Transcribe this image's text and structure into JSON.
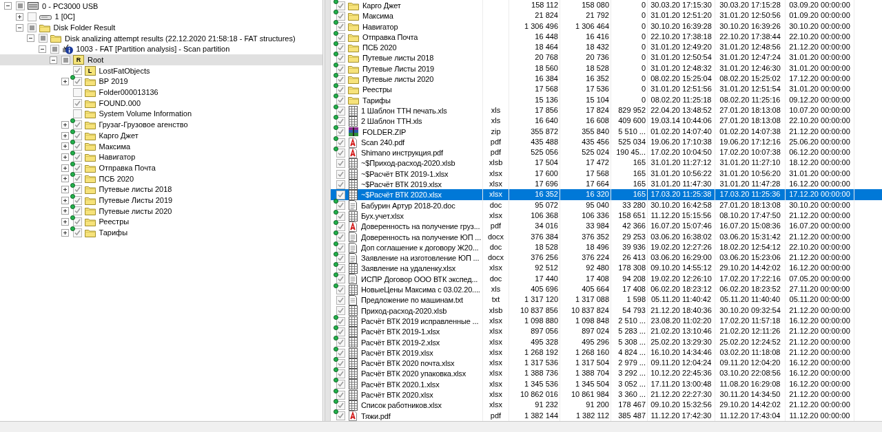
{
  "tree": [
    {
      "label": "0 - PC3000 USB",
      "kind": "drive",
      "checked": false,
      "indeterminate": true,
      "expanded": true,
      "marked": false,
      "selected": false,
      "children": [
        {
          "label": "1 [0C]",
          "kind": "disk",
          "checked": false,
          "indeterminate": false,
          "expanded": false,
          "marked": false,
          "selected": false
        },
        {
          "label": "Disk Folder Result",
          "kind": "folder",
          "checked": false,
          "indeterminate": true,
          "expanded": true,
          "marked": false,
          "selected": false,
          "children": [
            {
              "label": "Disk analizing attempt results (22.12.2020 21:58:18 - FAT structures)",
              "kind": "folder",
              "checked": false,
              "indeterminate": true,
              "expanded": true,
              "marked": false,
              "selected": false,
              "children": [
                {
                  "label": "1003 - FAT [Partition analysis] - Scan partition",
                  "kind": "info",
                  "checked": false,
                  "indeterminate": true,
                  "expanded": true,
                  "marked": false,
                  "selected": false,
                  "children": [
                    {
                      "label": "Root",
                      "kind": "lettered",
                      "letter": "R",
                      "checked": false,
                      "indeterminate": true,
                      "expanded": true,
                      "marked": false,
                      "selected": true,
                      "children": [
                        {
                          "label": "LostFatObjects",
                          "kind": "lettered",
                          "letter": "L",
                          "checked": true,
                          "indeterminate": false,
                          "marked": false,
                          "selected": false
                        },
                        {
                          "label": "ВР 2019",
                          "kind": "folder",
                          "checked": true,
                          "indeterminate": false,
                          "expanded": false,
                          "marked": true,
                          "selected": false
                        },
                        {
                          "label": "Folder000013136",
                          "kind": "folder",
                          "checked": false,
                          "indeterminate": false,
                          "marked": false,
                          "selected": false
                        },
                        {
                          "label": "FOUND.000",
                          "kind": "folder",
                          "checked": true,
                          "indeterminate": false,
                          "marked": false,
                          "selected": false
                        },
                        {
                          "label": "System Volume Information",
                          "kind": "folder",
                          "checked": false,
                          "indeterminate": false,
                          "marked": false,
                          "selected": false
                        },
                        {
                          "label": "Грузаг-Грузовое агенство",
                          "kind": "folder",
                          "checked": true,
                          "indeterminate": false,
                          "expanded": false,
                          "marked": true,
                          "selected": false
                        },
                        {
                          "label": "Карго Джет",
                          "kind": "folder",
                          "checked": true,
                          "indeterminate": false,
                          "expanded": false,
                          "marked": true,
                          "selected": false
                        },
                        {
                          "label": "Максима",
                          "kind": "folder",
                          "checked": true,
                          "indeterminate": false,
                          "expanded": false,
                          "marked": true,
                          "selected": false
                        },
                        {
                          "label": "Навигатор",
                          "kind": "folder",
                          "checked": true,
                          "indeterminate": false,
                          "expanded": false,
                          "marked": true,
                          "selected": false
                        },
                        {
                          "label": "Отправка Почта",
                          "kind": "folder",
                          "checked": true,
                          "indeterminate": false,
                          "expanded": false,
                          "marked": true,
                          "selected": false
                        },
                        {
                          "label": "ПСБ 2020",
                          "kind": "folder",
                          "checked": true,
                          "indeterminate": false,
                          "expanded": false,
                          "marked": true,
                          "selected": false
                        },
                        {
                          "label": "Путевые листы 2018",
                          "kind": "folder",
                          "checked": true,
                          "indeterminate": false,
                          "expanded": false,
                          "marked": true,
                          "selected": false
                        },
                        {
                          "label": "Путевые Листы 2019",
                          "kind": "folder",
                          "checked": true,
                          "indeterminate": false,
                          "expanded": false,
                          "marked": true,
                          "selected": false
                        },
                        {
                          "label": "Путевые листы 2020",
                          "kind": "folder",
                          "checked": true,
                          "indeterminate": false,
                          "expanded": false,
                          "marked": true,
                          "selected": false
                        },
                        {
                          "label": "Реестры",
                          "kind": "folder",
                          "checked": true,
                          "indeterminate": false,
                          "expanded": false,
                          "marked": true,
                          "selected": false
                        },
                        {
                          "label": "Тарифы",
                          "kind": "folder",
                          "checked": true,
                          "indeterminate": false,
                          "expanded": false,
                          "marked": true,
                          "selected": false
                        }
                      ]
                    }
                  ]
                }
              ]
            }
          ]
        }
      ]
    }
  ],
  "files": [
    {
      "name": "Карго Джет",
      "kind": "folder",
      "checked": true,
      "marked": true,
      "selected": false,
      "cells": [
        "158 112",
        "158 080",
        "0",
        "30.03.20 17:15:30",
        "30.03.20 17:15:28",
        "03.09.20 00:00:00"
      ]
    },
    {
      "name": "Максима",
      "kind": "folder",
      "checked": true,
      "marked": true,
      "selected": false,
      "cells": [
        "21 824",
        "21 792",
        "0",
        "31.01.20 12:51:20",
        "31.01.20 12:50:56",
        "01.09.20 00:00:00"
      ]
    },
    {
      "name": "Навигатор",
      "kind": "folder",
      "checked": true,
      "marked": true,
      "selected": false,
      "cells": [
        "1 306 496",
        "1 306 464",
        "0",
        "30.10.20 16:39:28",
        "30.10.20 16:39:26",
        "30.10.20 00:00:00"
      ]
    },
    {
      "name": "Отправка Почта",
      "kind": "folder",
      "checked": true,
      "marked": true,
      "selected": false,
      "cells": [
        "16 448",
        "16 416",
        "0",
        "22.10.20 17:38:18",
        "22.10.20 17:38:44",
        "22.10.20 00:00:00"
      ]
    },
    {
      "name": "ПСБ 2020",
      "kind": "folder",
      "checked": true,
      "marked": true,
      "selected": false,
      "cells": [
        "18 464",
        "18 432",
        "0",
        "31.01.20 12:49:20",
        "31.01.20 12:48:56",
        "21.12.20 00:00:00"
      ]
    },
    {
      "name": "Путевые листы 2018",
      "kind": "folder",
      "checked": true,
      "marked": true,
      "selected": false,
      "cells": [
        "20 768",
        "20 736",
        "0",
        "31.01.20 12:50:54",
        "31.01.20 12:47:24",
        "31.01.20 00:00:00"
      ]
    },
    {
      "name": "Путевые Листы 2019",
      "kind": "folder",
      "checked": true,
      "marked": true,
      "selected": false,
      "cells": [
        "18 560",
        "18 528",
        "0",
        "31.01.20 12:48:32",
        "31.01.20 12:46:30",
        "31.01.20 00:00:00"
      ]
    },
    {
      "name": "Путевые листы 2020",
      "kind": "folder",
      "checked": true,
      "marked": true,
      "selected": false,
      "cells": [
        "16 384",
        "16 352",
        "0",
        "08.02.20 15:25:04",
        "08.02.20 15:25:02",
        "17.12.20 00:00:00"
      ]
    },
    {
      "name": "Реестры",
      "kind": "folder",
      "checked": true,
      "marked": true,
      "selected": false,
      "cells": [
        "17 568",
        "17 536",
        "0",
        "31.01.20 12:51:56",
        "31.01.20 12:51:54",
        "31.01.20 00:00:00"
      ]
    },
    {
      "name": "Тарифы",
      "kind": "folder",
      "checked": true,
      "marked": true,
      "selected": false,
      "cells": [
        "15 136",
        "15 104",
        "0",
        "08.02.20 11:25:18",
        "08.02.20 11:25:16",
        "09.12.20 00:00:00"
      ]
    },
    {
      "name": "1 Шаблон ТТН печать.xls",
      "ext": "xls",
      "kind": "sheet",
      "checked": true,
      "marked": true,
      "selected": false,
      "cells": [
        "17 856",
        "17 824",
        "829 952",
        "22.04.20 13:48:52",
        "27.01.20 18:13:08",
        "10.07.20 00:00:00"
      ]
    },
    {
      "name": "2 Шаблон ТТН.xls",
      "ext": "xls",
      "kind": "sheet",
      "checked": true,
      "marked": true,
      "selected": false,
      "cells": [
        "16 640",
        "16 608",
        "409 600",
        "19.03.14 10:44:06",
        "27.01.20 18:13:08",
        "22.10.20 00:00:00"
      ]
    },
    {
      "name": "FOLDER.ZIP",
      "ext": "zip",
      "kind": "archive",
      "checked": true,
      "marked": true,
      "selected": false,
      "cells": [
        "355 872",
        "355 840",
        "5 510 ...",
        "01.02.20 14:07:40",
        "01.02.20 14:07:38",
        "21.12.20 00:00:00"
      ]
    },
    {
      "name": "Scan 240.pdf",
      "ext": "pdf",
      "kind": "pdf",
      "checked": true,
      "marked": true,
      "selected": false,
      "cells": [
        "435 488",
        "435 456",
        "525 034",
        "19.06.20 17:10:38",
        "19.06.20 17:12:16",
        "25.06.20 00:00:00"
      ]
    },
    {
      "name": "Shimano инструкция.pdf",
      "ext": "pdf",
      "kind": "pdf",
      "checked": true,
      "marked": true,
      "selected": false,
      "cells": [
        "525 056",
        "525 024",
        "190 45...",
        "17.02.20 10:04:50",
        "17.02.20 10:07:38",
        "06.12.20 00:00:00"
      ]
    },
    {
      "name": "~$Приход-расход-2020.xlsb",
      "ext": "xlsb",
      "kind": "sheet",
      "checked": true,
      "marked": false,
      "selected": false,
      "cells": [
        "17 504",
        "17 472",
        "165",
        "31.01.20 11:27:12",
        "31.01.20 11:27:10",
        "18.12.20 00:00:00"
      ]
    },
    {
      "name": "~$Расчёт ВТК 2019-1.xlsx",
      "ext": "xlsx",
      "kind": "sheet",
      "checked": true,
      "marked": false,
      "selected": false,
      "cells": [
        "17 600",
        "17 568",
        "165",
        "31.01.20 10:56:22",
        "31.01.20 10:56:20",
        "31.01.20 00:00:00"
      ]
    },
    {
      "name": "~$Расчёт ВТК 2019.xlsx",
      "ext": "xlsx",
      "kind": "sheet",
      "checked": true,
      "marked": false,
      "selected": false,
      "cells": [
        "17 696",
        "17 664",
        "165",
        "31.01.20 11:47:30",
        "31.01.20 11:47:28",
        "16.12.20 00:00:00"
      ]
    },
    {
      "name": "~$Расчёт ВТК 2020.xlsx",
      "ext": "xlsx",
      "kind": "sheet",
      "checked": true,
      "marked": false,
      "selected": true,
      "cells": [
        "16 352",
        "16 320",
        "165",
        "17.03.20 11:25:38",
        "17.03.20 11:25:36",
        "17.12.20 00:00:00"
      ]
    },
    {
      "name": "Бабурин Артур 2018-20.doc",
      "ext": "doc",
      "kind": "doc",
      "checked": true,
      "marked": true,
      "selected": false,
      "cells": [
        "95 072",
        "95 040",
        "33 280",
        "30.10.20 16:42:58",
        "27.01.20 18:13:08",
        "30.10.20 00:00:00"
      ]
    },
    {
      "name": "Бух.учет.xlsx",
      "ext": "xlsx",
      "kind": "sheet",
      "checked": true,
      "marked": true,
      "selected": false,
      "cells": [
        "106 368",
        "106 336",
        "158 651",
        "11.12.20 15:15:56",
        "08.10.20 17:47:50",
        "21.12.20 00:00:00"
      ]
    },
    {
      "name": "Доверенность на получение груз...",
      "ext": "pdf",
      "kind": "pdf",
      "checked": true,
      "marked": true,
      "selected": false,
      "cells": [
        "34 016",
        "33 984",
        "42 366",
        "16.07.20 15:07:46",
        "16.07.20 15:08:36",
        "16.07.20 00:00:00"
      ]
    },
    {
      "name": "Доверенность на получение ЮП ...",
      "ext": "docx",
      "kind": "doc",
      "checked": true,
      "marked": true,
      "selected": false,
      "cells": [
        "376 384",
        "376 352",
        "29 253",
        "03.06.20 16:38:02",
        "03.06.20 15:31:42",
        "21.12.20 00:00:00"
      ]
    },
    {
      "name": "Доп соглашение к договору Ж20...",
      "ext": "doc",
      "kind": "doc",
      "checked": true,
      "marked": true,
      "selected": false,
      "cells": [
        "18 528",
        "18 496",
        "39 936",
        "19.02.20 12:27:26",
        "18.02.20 12:54:12",
        "22.10.20 00:00:00"
      ]
    },
    {
      "name": "Заявление на изготовление ЮП ...",
      "ext": "docx",
      "kind": "doc",
      "checked": true,
      "marked": true,
      "selected": false,
      "cells": [
        "376 256",
        "376 224",
        "26 413",
        "03.06.20 16:29:00",
        "03.06.20 15:23:06",
        "21.12.20 00:00:00"
      ]
    },
    {
      "name": "Заявление на удаленку.xlsx",
      "ext": "xlsx",
      "kind": "sheet",
      "checked": true,
      "marked": true,
      "selected": false,
      "cells": [
        "92 512",
        "92 480",
        "178 308",
        "09.10.20 14:55:12",
        "29.10.20 14:42:02",
        "16.12.20 00:00:00"
      ]
    },
    {
      "name": "ИСПР Договор ООО ВТК экспед...",
      "ext": "doc",
      "kind": "doc",
      "checked": true,
      "marked": true,
      "selected": false,
      "cells": [
        "17 440",
        "17 408",
        "94 208",
        "19.02.20 12:26:10",
        "17.02.20 17:22:16",
        "07.05.20 00:00:00"
      ]
    },
    {
      "name": "НовыеЦены Максима с 03.02.20....",
      "ext": "xls",
      "kind": "sheet",
      "checked": true,
      "marked": true,
      "selected": false,
      "cells": [
        "405 696",
        "405 664",
        "17 408",
        "06.02.20 18:23:12",
        "06.02.20 18:23:52",
        "27.11.20 00:00:00"
      ]
    },
    {
      "name": "Предложение по машинам.txt",
      "ext": "txt",
      "kind": "text",
      "checked": true,
      "marked": false,
      "selected": false,
      "cells": [
        "1 317 120",
        "1 317 088",
        "1 598",
        "05.11.20 11:40:42",
        "05.11.20 11:40:40",
        "05.11.20 00:00:00"
      ]
    },
    {
      "name": "Приход-расход-2020.xlsb",
      "ext": "xlsb",
      "kind": "sheet",
      "checked": true,
      "marked": false,
      "selected": false,
      "cells": [
        "10 837 856",
        "10 837 824",
        "54 793",
        "21.12.20 18:40:36",
        "30.10.20 09:32:54",
        "21.12.20 00:00:00"
      ]
    },
    {
      "name": "Расчёт ВТК 2019 исправленные ...",
      "ext": "xlsx",
      "kind": "sheet",
      "checked": true,
      "marked": true,
      "selected": false,
      "cells": [
        "1 098 880",
        "1 098 848",
        "2 510 ...",
        "23.08.20 11:02:20",
        "17.02.20 11:57:18",
        "16.12.20 00:00:00"
      ]
    },
    {
      "name": "Расчёт ВТК 2019-1.xlsx",
      "ext": "xlsx",
      "kind": "sheet",
      "checked": true,
      "marked": true,
      "selected": false,
      "cells": [
        "897 056",
        "897 024",
        "5 283 ...",
        "21.02.20 13:10:46",
        "21.02.20 12:11:26",
        "21.12.20 00:00:00"
      ]
    },
    {
      "name": "Расчёт ВТК 2019-2.xlsx",
      "ext": "xlsx",
      "kind": "sheet",
      "checked": true,
      "marked": true,
      "selected": false,
      "cells": [
        "495 328",
        "495 296",
        "5 308 ...",
        "25.02.20 13:29:30",
        "25.02.20 12:24:52",
        "21.12.20 00:00:00"
      ]
    },
    {
      "name": "Расчёт ВТК 2019.xlsx",
      "ext": "xlsx",
      "kind": "sheet",
      "checked": true,
      "marked": true,
      "selected": false,
      "cells": [
        "1 268 192",
        "1 268 160",
        "4 824 ...",
        "16.10.20 14:34:46",
        "03.02.20 11:18:08",
        "21.12.20 00:00:00"
      ]
    },
    {
      "name": "Расчёт ВТК 2020 почта.xlsx",
      "ext": "xlsx",
      "kind": "sheet",
      "checked": true,
      "marked": true,
      "selected": false,
      "cells": [
        "1 317 536",
        "1 317 504",
        "2 979 ...",
        "09.11.20 12:04:24",
        "09.11.20 12:04:20",
        "16.12.20 00:00:00"
      ]
    },
    {
      "name": "Расчёт ВТК 2020 упаковка.xlsx",
      "ext": "xlsx",
      "kind": "sheet",
      "checked": true,
      "marked": true,
      "selected": false,
      "cells": [
        "1 388 736",
        "1 388 704",
        "3 292 ...",
        "10.12.20 22:45:36",
        "03.10.20 22:08:56",
        "16.12.20 00:00:00"
      ]
    },
    {
      "name": "Расчёт ВТК 2020.1.xlsx",
      "ext": "xlsx",
      "kind": "sheet",
      "checked": true,
      "marked": true,
      "selected": false,
      "cells": [
        "1 345 536",
        "1 345 504",
        "3 052 ...",
        "17.11.20 13:00:48",
        "11.08.20 16:29:08",
        "16.12.20 00:00:00"
      ]
    },
    {
      "name": "Расчёт ВТК 2020.xlsx",
      "ext": "xlsx",
      "kind": "sheet",
      "checked": true,
      "marked": true,
      "selected": false,
      "cells": [
        "10 862 016",
        "10 861 984",
        "3 360 ...",
        "21.12.20 22:27:30",
        "30.11.20 14:34:50",
        "21.12.20 00:00:00"
      ]
    },
    {
      "name": "Список работников.xlsx",
      "ext": "xlsx",
      "kind": "sheet",
      "checked": true,
      "marked": true,
      "selected": false,
      "cells": [
        "91 232",
        "91 200",
        "178 467",
        "09.10.20 15:32:56",
        "29.10.20 14:42:02",
        "21.12.20 00:00:00"
      ]
    },
    {
      "name": "Тяжи.pdf",
      "ext": "pdf",
      "kind": "pdf",
      "checked": true,
      "marked": true,
      "selected": false,
      "cells": [
        "1 382 144",
        "1 382 112",
        "385 487",
        "11.12.20 17:42:30",
        "11.12.20 17:43:04",
        "11.12.20 00:00:00"
      ]
    }
  ]
}
